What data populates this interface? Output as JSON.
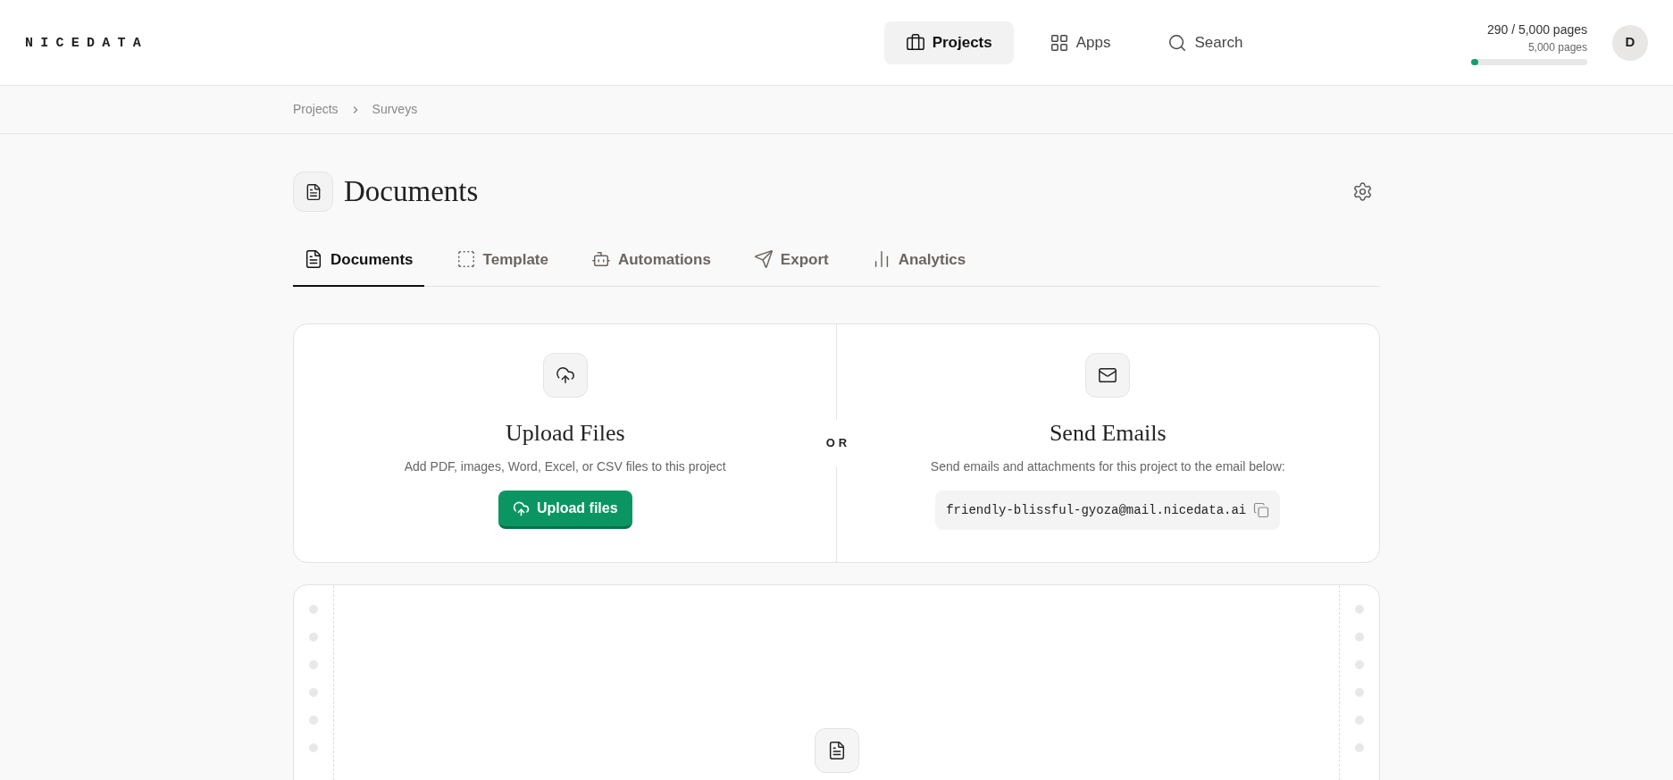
{
  "logo": "NICEDATA",
  "nav": [
    {
      "label": "Projects",
      "selected": true
    },
    {
      "label": "Apps",
      "selected": false
    },
    {
      "label": "Search",
      "selected": false
    }
  ],
  "usage": {
    "reading": "290 / 5,000 pages",
    "limit": "5,000 pages",
    "level": 0.058
  },
  "avatar": "D",
  "breadcrumb": [
    "Projects",
    "Surveys"
  ],
  "page_title": "Documents",
  "tabs": [
    {
      "label": "Documents",
      "selected": true
    },
    {
      "label": "Template",
      "selected": false
    },
    {
      "label": "Automations",
      "selected": false
    },
    {
      "label": "Export",
      "selected": false
    },
    {
      "label": "Analytics",
      "selected": false
    }
  ],
  "upload": {
    "title": "Upload Files",
    "description": "Add PDF, images, Word, Excel, or CSV files to this project",
    "button": "Upload files"
  },
  "divider_label": "OR",
  "email": {
    "title": "Send Emails",
    "description": "Send emails and attachments for this project to the email below:",
    "address": "friendly-blissful-gyoza@mail.nicedata.ai"
  }
}
